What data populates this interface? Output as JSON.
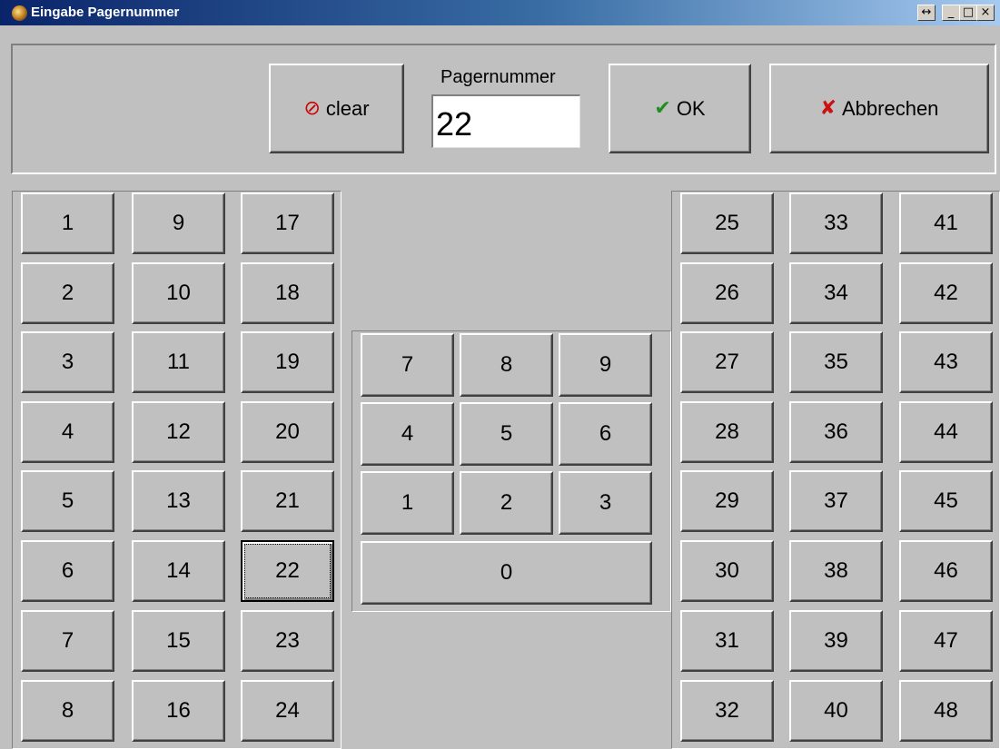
{
  "window": {
    "title": "Eingabe Pagernummer",
    "controls": [
      "↔",
      "_",
      "□",
      "×"
    ]
  },
  "toolbar": {
    "clear_label": "clear",
    "pager_label": "Pagernummer",
    "pager_value": "22",
    "ok_label": "OK",
    "cancel_label": "Abbrechen"
  },
  "icons": {
    "clear": "⊘",
    "ok": "✔",
    "cancel": "✘"
  },
  "left_grid": {
    "col1": [
      "1",
      "2",
      "3",
      "4",
      "5",
      "6",
      "7",
      "8"
    ],
    "col2": [
      "9",
      "10",
      "11",
      "12",
      "13",
      "14",
      "15",
      "16"
    ],
    "col3": [
      "17",
      "18",
      "19",
      "20",
      "21",
      "22",
      "23",
      "24"
    ]
  },
  "right_grid": {
    "col1": [
      "25",
      "26",
      "27",
      "28",
      "29",
      "30",
      "31",
      "32"
    ],
    "col2": [
      "33",
      "34",
      "35",
      "36",
      "37",
      "38",
      "39",
      "40"
    ],
    "col3": [
      "41",
      "42",
      "43",
      "44",
      "45",
      "46",
      "47",
      "48"
    ]
  },
  "keypad": {
    "rows": [
      [
        "7",
        "8",
        "9"
      ],
      [
        "4",
        "5",
        "6"
      ],
      [
        "1",
        "2",
        "3"
      ]
    ],
    "zero": "0"
  },
  "selected_pager": "22"
}
